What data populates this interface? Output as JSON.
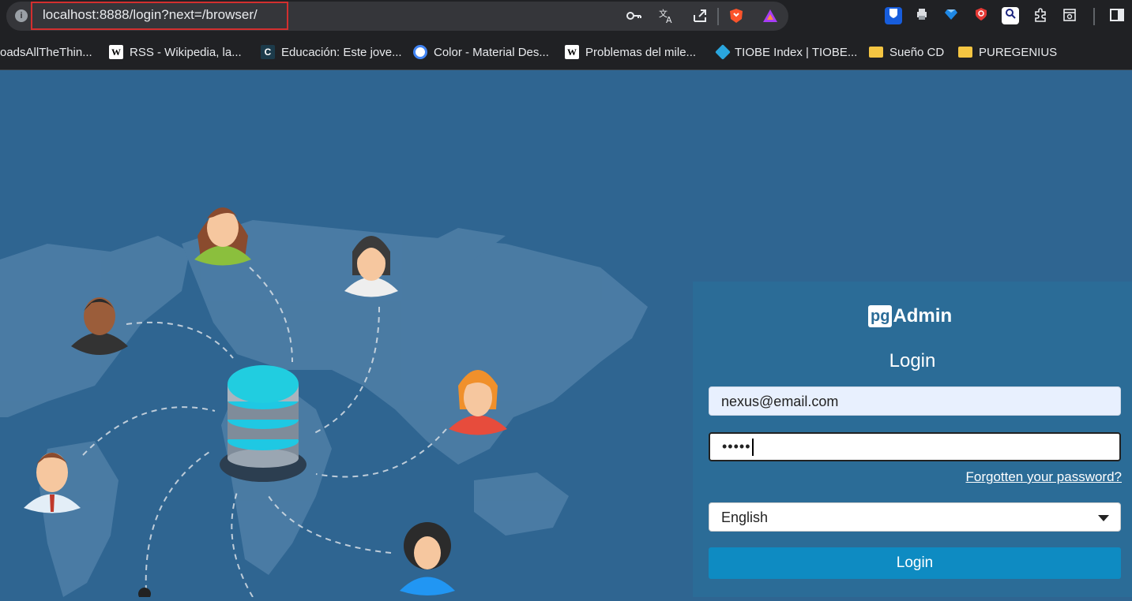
{
  "browser": {
    "url": "localhost:8888/login?next=/browser/",
    "info_icon": "i",
    "toolbar_icons": [
      "key-icon",
      "translate-icon",
      "share-icon",
      "brave-shield-icon",
      "rewards-icon"
    ],
    "extensions": [
      "bitwarden-icon",
      "printer-icon",
      "gem-icon",
      "shield-icon",
      "search-icon",
      "puzzle-icon",
      "reader-icon",
      "sidebar-icon"
    ]
  },
  "bookmarks": [
    {
      "label": "oadsAllTheThin...",
      "icon": "none"
    },
    {
      "label": "RSS - Wikipedia, la...",
      "icon": "wikipedia-icon",
      "glyph": "W"
    },
    {
      "label": "Educación: Este jove...",
      "icon": "c-icon",
      "glyph": "C"
    },
    {
      "label": "Color - Material Des...",
      "icon": "material-icon",
      "glyph": ""
    },
    {
      "label": "Problemas del mile...",
      "icon": "wikipedia-icon",
      "glyph": "W"
    },
    {
      "label": "TIOBE Index | TIOBE...",
      "icon": "tiobe-icon",
      "glyph": ""
    },
    {
      "label": "Sueño CD",
      "icon": "folder-icon",
      "glyph": ""
    },
    {
      "label": "PUREGENIUS",
      "icon": "folder-icon",
      "glyph": ""
    }
  ],
  "login": {
    "logo_pg": "pg",
    "logo_admin": "Admin",
    "title": "Login",
    "email_value": "nexus@email.com",
    "password_mask": "•••••",
    "forgot_link": "Forgotten your password?",
    "language": "English",
    "button": "Login"
  },
  "colors": {
    "background": "#2f6591",
    "panel": "#2b6c97",
    "button": "#0e8bc2"
  }
}
